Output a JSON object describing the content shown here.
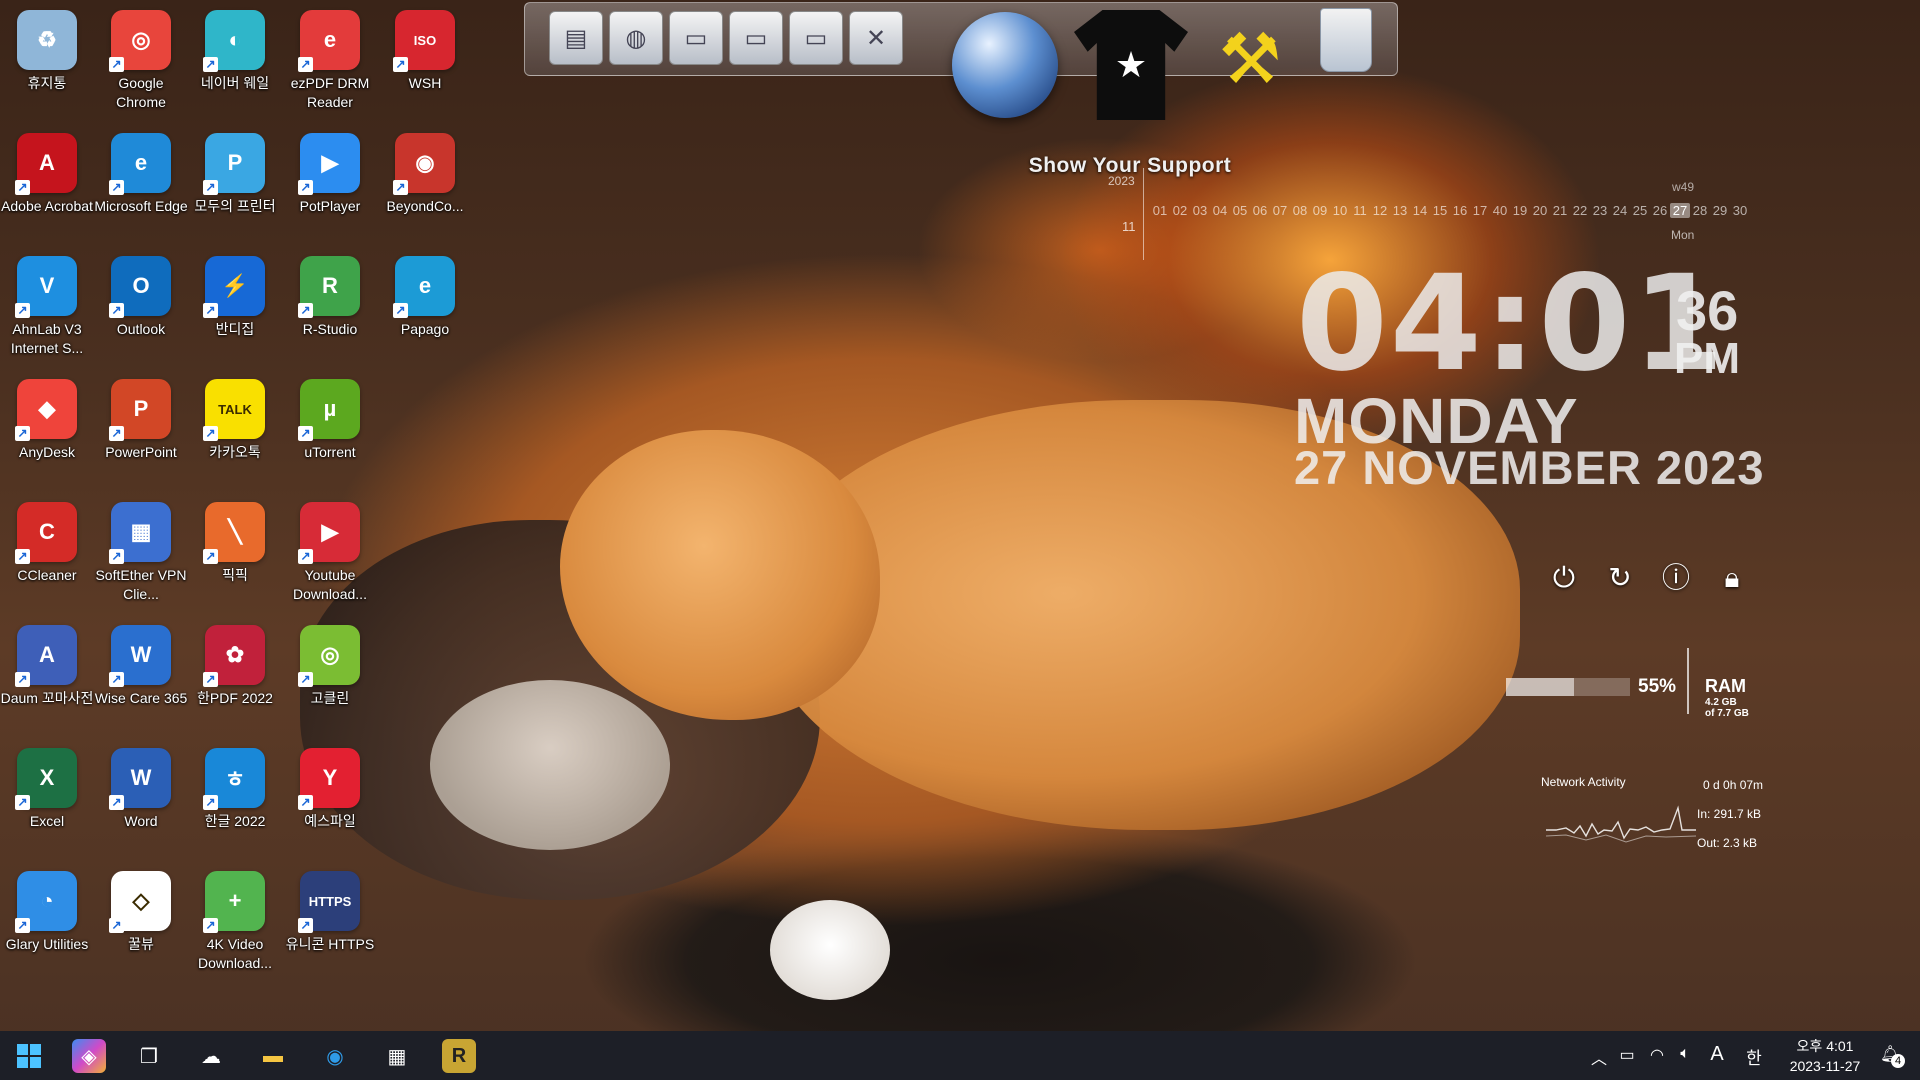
{
  "desktop": {
    "icons": [
      {
        "label": "휴지통",
        "color": "#8fb6d8",
        "glyph": "♻",
        "col": 0,
        "row": 0
      },
      {
        "label": "Google Chrome",
        "color": "#e8453c",
        "glyph": "◎",
        "col": 1,
        "row": 0
      },
      {
        "label": "네이버 웨일",
        "color": "#2fb6c9",
        "glyph": "◐",
        "col": 2,
        "row": 0
      },
      {
        "label": "ezPDF DRM Reader",
        "color": "#e33b3b",
        "glyph": "e",
        "col": 3,
        "row": 0
      },
      {
        "label": "WSH",
        "color": "#d7262f",
        "glyph": "ISO",
        "col": 4,
        "row": 0
      },
      {
        "label": "Adobe Acrobat",
        "color": "#c5141d",
        "glyph": "A",
        "col": 0,
        "row": 1
      },
      {
        "label": "Microsoft Edge",
        "color": "#1f8ad8",
        "glyph": "e",
        "col": 1,
        "row": 1
      },
      {
        "label": "모두의 프린터",
        "color": "#3aa7e3",
        "glyph": "P",
        "col": 2,
        "row": 1
      },
      {
        "label": "PotPlayer",
        "color": "#2c8df0",
        "glyph": "▶",
        "col": 3,
        "row": 1
      },
      {
        "label": "BeyondCo...",
        "color": "#c8352c",
        "glyph": "◉",
        "col": 4,
        "row": 1
      },
      {
        "label": "AhnLab V3 Internet S...",
        "color": "#1e8fe0",
        "glyph": "V",
        "col": 0,
        "row": 2
      },
      {
        "label": "Outlook",
        "color": "#0f6cbd",
        "glyph": "O",
        "col": 1,
        "row": 2
      },
      {
        "label": "반디집",
        "color": "#1769d6",
        "glyph": "⚡",
        "col": 2,
        "row": 2
      },
      {
        "label": "R-Studio",
        "color": "#3fa34a",
        "glyph": "R",
        "col": 3,
        "row": 2
      },
      {
        "label": "Papago",
        "color": "#1c9bd6",
        "glyph": "e",
        "col": 4,
        "row": 2
      },
      {
        "label": "AnyDesk",
        "color": "#ef443b",
        "glyph": "◆",
        "col": 0,
        "row": 3
      },
      {
        "label": "PowerPoint",
        "color": "#d24726",
        "glyph": "P",
        "col": 1,
        "row": 3
      },
      {
        "label": "카카오톡",
        "color": "#f9e000",
        "glyph": "TALK",
        "col": 2,
        "row": 3
      },
      {
        "label": "uTorrent",
        "color": "#5ca81f",
        "glyph": "µ",
        "col": 3,
        "row": 3
      },
      {
        "label": "CCleaner",
        "color": "#d42b27",
        "glyph": "C",
        "col": 0,
        "row": 4
      },
      {
        "label": "SoftEther VPN Clie...",
        "color": "#3c6fd0",
        "glyph": "▦",
        "col": 1,
        "row": 4
      },
      {
        "label": "픽픽",
        "color": "#e86a2c",
        "glyph": "╲",
        "col": 2,
        "row": 4
      },
      {
        "label": "Youtube Download...",
        "color": "#d72b37",
        "glyph": "▶",
        "col": 3,
        "row": 4
      },
      {
        "label": "Daum 꼬마사전",
        "color": "#3e5fb8",
        "glyph": "A",
        "col": 0,
        "row": 5
      },
      {
        "label": "Wise Care 365",
        "color": "#2a6fcf",
        "glyph": "W",
        "col": 1,
        "row": 5
      },
      {
        "label": "한PDF 2022",
        "color": "#c1213b",
        "glyph": "✿",
        "col": 2,
        "row": 5
      },
      {
        "label": "고클린",
        "color": "#7bbd33",
        "glyph": "◎",
        "col": 3,
        "row": 5
      },
      {
        "label": "Excel",
        "color": "#1d7044",
        "glyph": "X",
        "col": 0,
        "row": 6
      },
      {
        "label": "Word",
        "color": "#2b5fb6",
        "glyph": "W",
        "col": 1,
        "row": 6
      },
      {
        "label": "한글 2022",
        "color": "#1988d8",
        "glyph": "ㅎ",
        "col": 2,
        "row": 6
      },
      {
        "label": "예스파일",
        "color": "#e32031",
        "glyph": "Y",
        "col": 3,
        "row": 6
      },
      {
        "label": "Glary Utilities",
        "color": "#2f8ee6",
        "glyph": "◔",
        "col": 0,
        "row": 7
      },
      {
        "label": "꿀뷰",
        "color": "#ffffff",
        "glyph": "◇",
        "col": 1,
        "row": 7
      },
      {
        "label": "4K Video Download...",
        "color": "#52b44f",
        "glyph": "+",
        "col": 2,
        "row": 7
      },
      {
        "label": "유니콘 HTTPS",
        "color": "#2c3f7a",
        "glyph": "HTTPS",
        "col": 3,
        "row": 7
      }
    ]
  },
  "widget": {
    "support_text": "Show Your Support",
    "calendar": {
      "year": "2023",
      "month": "11",
      "week": "w49",
      "dow": "Mon",
      "days": [
        "01",
        "02",
        "03",
        "04",
        "05",
        "06",
        "07",
        "08",
        "09",
        "10",
        "11",
        "12",
        "13",
        "14",
        "15",
        "16",
        "17",
        "40",
        "19",
        "20",
        "21",
        "22",
        "23",
        "24",
        "25",
        "26",
        "27",
        "28",
        "29",
        "30"
      ],
      "today": "27"
    },
    "clock": {
      "time": "04:01",
      "seconds": "36",
      "ampm": "PM",
      "weekday": "MONDAY",
      "date": "27 NOVEMBER 2023"
    },
    "ram": {
      "percent": 55,
      "percent_label": "55%",
      "label": "RAM",
      "used": "4.2 GB",
      "total": "of 7.7 GB"
    },
    "network": {
      "title": "Network Activity",
      "uptime": "0 d 0h 07m",
      "in": "In: 291.7 kB",
      "out": "Out: 2.3 kB"
    }
  },
  "taskbar": {
    "tray": {
      "ime_a": "A",
      "ime_han": "한",
      "time": "오후 4:01",
      "date": "2023-11-27",
      "notifications": "4"
    }
  }
}
